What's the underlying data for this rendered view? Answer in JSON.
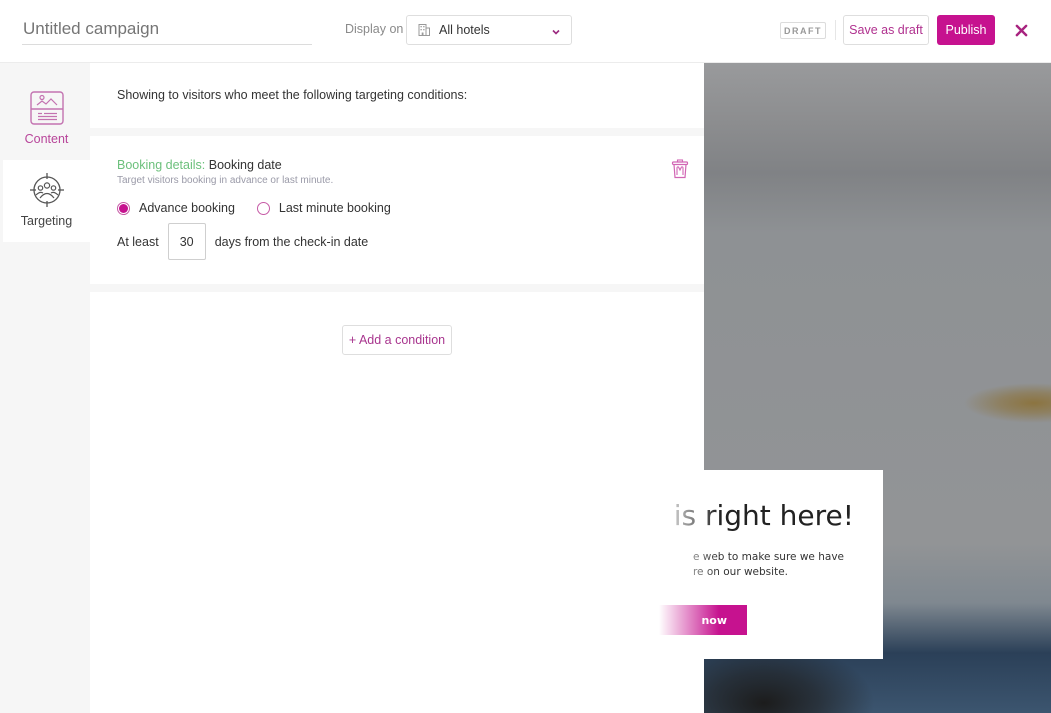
{
  "header": {
    "campaign_title_placeholder": "Untitled campaign",
    "display_on_label": "Display on",
    "hotel_selector": {
      "selected": "All hotels",
      "icon": "building-icon"
    },
    "status_badge": "DRAFT",
    "save_draft_label": "Save as draft",
    "publish_label": "Publish",
    "close_icon": "close-icon"
  },
  "sidebar": {
    "items": [
      {
        "label": "Content",
        "icon": "content-image-text-icon",
        "active": false
      },
      {
        "label": "Targeting",
        "icon": "targeting-audience-icon",
        "active": true
      }
    ]
  },
  "targeting": {
    "intro": "Showing to visitors who meet the following targeting conditions:",
    "conditions": [
      {
        "category": "Booking details:",
        "name": "Booking date",
        "description": "Target visitors booking in advance or last minute.",
        "options": [
          {
            "label": "Advance booking",
            "selected": true
          },
          {
            "label": "Last minute booking",
            "selected": false
          }
        ],
        "prefix": "At least",
        "days_value": "30",
        "suffix": "days from the check-in date"
      }
    ],
    "add_condition_label": "+ Add a condition"
  },
  "preview": {
    "headline": "is right here!",
    "body_line1": "e web to make sure we have",
    "body_line2": "re on our website.",
    "cta_label": "now"
  },
  "colors": {
    "accent": "#c6128f",
    "category_green": "#6cc07c",
    "sidebar_bg": "#f6f6f6"
  }
}
